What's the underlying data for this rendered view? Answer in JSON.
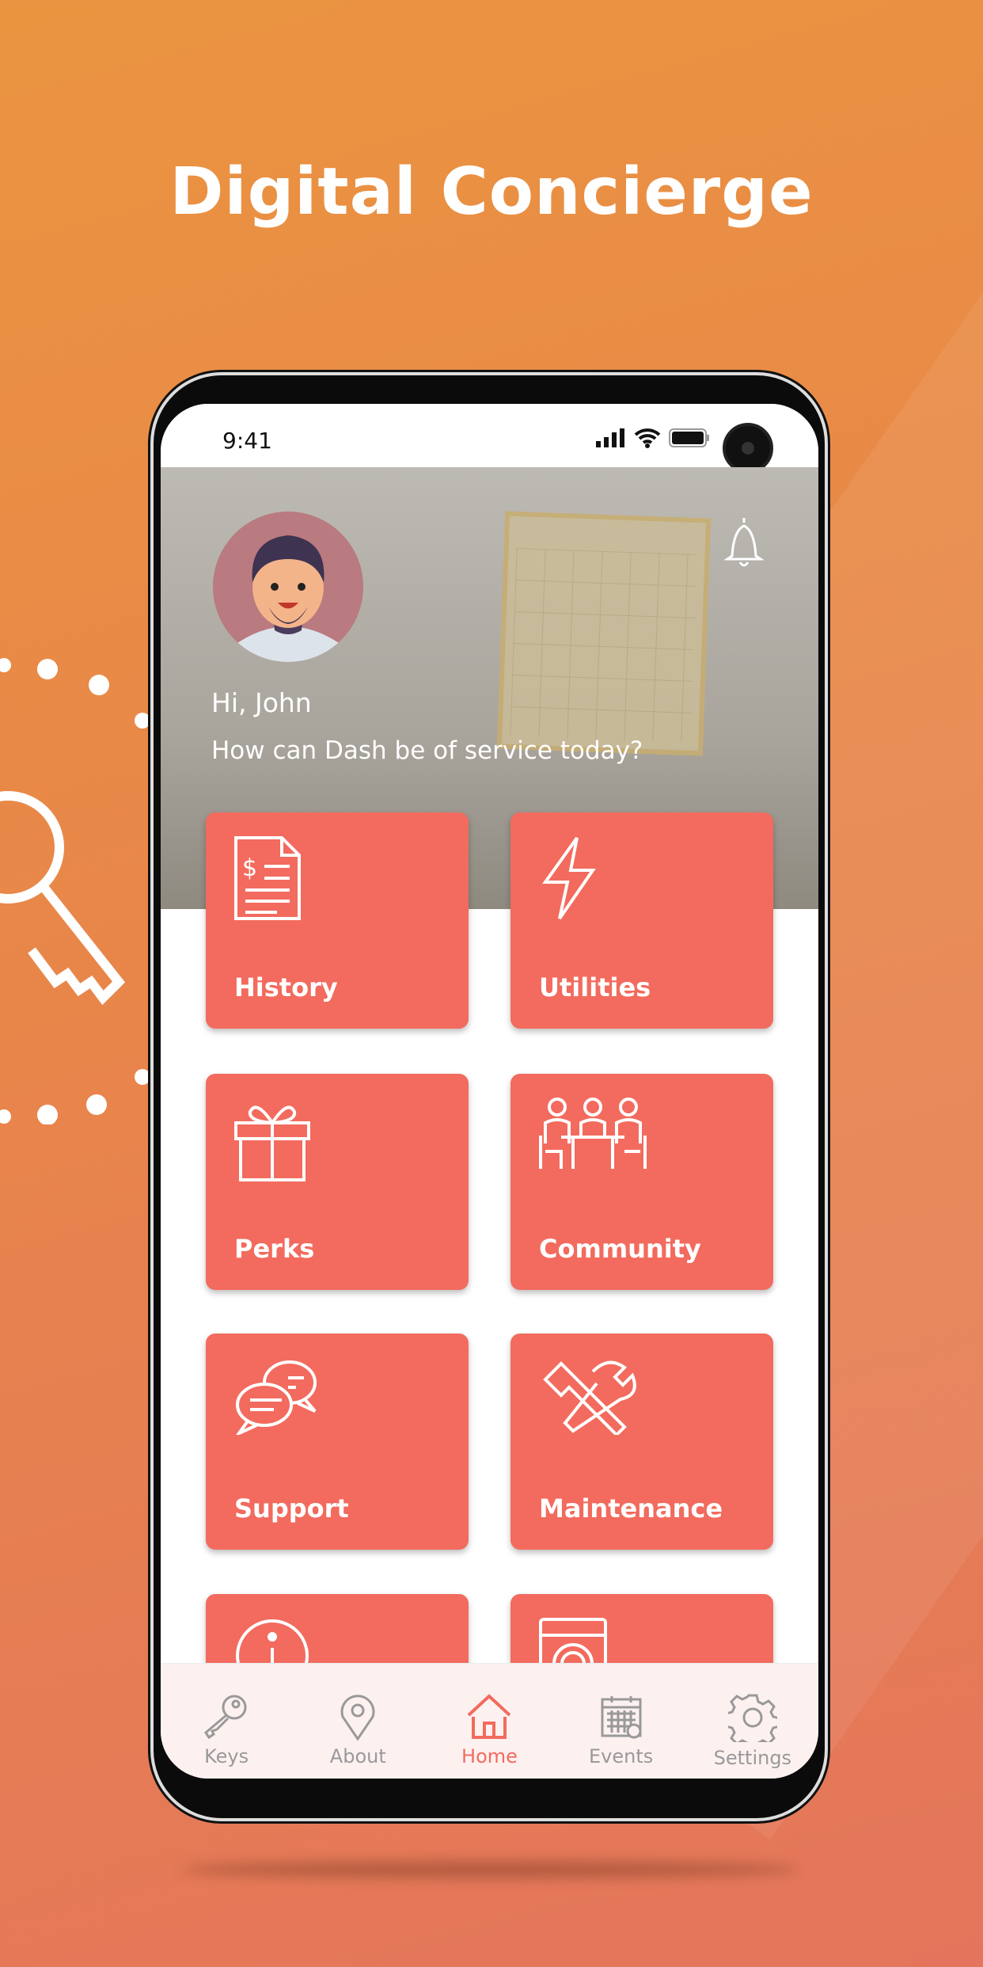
{
  "title": "Digital Concierge",
  "status": {
    "time": "9:41"
  },
  "header": {
    "greeting": "Hi, John",
    "subtitle": "How can Dash be of service today?"
  },
  "tiles": [
    {
      "label": "History",
      "icon": "invoice-icon"
    },
    {
      "label": "Utilities",
      "icon": "lightning-icon"
    },
    {
      "label": "Perks",
      "icon": "gift-icon"
    },
    {
      "label": "Community",
      "icon": "people-table-icon"
    },
    {
      "label": "Support",
      "icon": "chat-bubbles-icon"
    },
    {
      "label": "Maintenance",
      "icon": "tools-icon"
    },
    {
      "label": "",
      "icon": "info-icon"
    },
    {
      "label": "",
      "icon": "washing-machine-icon"
    }
  ],
  "nav": [
    {
      "label": "Keys",
      "icon": "key-icon"
    },
    {
      "label": "About",
      "icon": "location-pin-icon"
    },
    {
      "label": "Home",
      "icon": "home-icon",
      "active": true
    },
    {
      "label": "Events",
      "icon": "calendar-icon"
    },
    {
      "label": "Settings",
      "icon": "gear-icon"
    }
  ],
  "colors": {
    "accent": "#f26b5e",
    "background": "#e8864a",
    "nav_inactive": "#999999"
  }
}
